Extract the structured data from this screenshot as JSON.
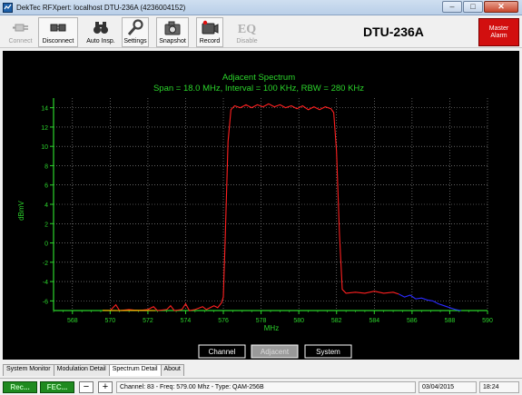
{
  "window": {
    "title": "DekTec RFXpert: localhost  DTU-236A (4236004152)",
    "buttons": {
      "minimize": "–",
      "maximize": "□",
      "close": "✕"
    }
  },
  "toolbar": {
    "items": [
      {
        "label": "Connect",
        "icon": "plug-icon",
        "enabled": false
      },
      {
        "label": "Disconnect",
        "icon": "unplug-icon",
        "enabled": true
      },
      {
        "label": "Auto Insp.",
        "icon": "binoculars-icon",
        "enabled": true
      },
      {
        "label": "Settings",
        "icon": "wrench-icon",
        "enabled": true
      },
      {
        "label": "Snapshot",
        "icon": "camera-icon",
        "enabled": true
      },
      {
        "label": "Record",
        "icon": "record-icon",
        "enabled": true
      },
      {
        "label": "Disable",
        "icon": "eq-icon",
        "enabled": false,
        "icon_text": "EQ"
      }
    ],
    "device_name": "DTU-236A",
    "alarm": {
      "line1": "Master",
      "line2": "Alarm",
      "color": "#d20f0f"
    }
  },
  "chart_data": {
    "type": "line",
    "title": "Adjacent Spectrum",
    "subtitle": "Span = 18.0 MHz, Interval = 100 KHz, RBW = 280 KHz",
    "xlabel": "MHz",
    "ylabel": "dBmV",
    "xlim": [
      567,
      590
    ],
    "ylim": [
      -7,
      15
    ],
    "xticks": [
      568,
      570,
      572,
      574,
      576,
      578,
      580,
      582,
      584,
      586,
      588,
      590
    ],
    "yticks": [
      -6,
      -4,
      -2,
      0,
      2,
      4,
      6,
      8,
      10,
      12,
      14
    ],
    "grid": true,
    "colors": {
      "axis": "#2bd42b",
      "title": "#2bd42b",
      "grid": "#9a9a9a",
      "background": "#000000"
    },
    "series": [
      {
        "color": "#ff2020",
        "points": [
          [
            570.0,
            -7.0
          ],
          [
            570.3,
            -6.4
          ],
          [
            570.5,
            -7.0
          ],
          [
            571.0,
            -6.9
          ],
          [
            571.5,
            -7.0
          ],
          [
            572.0,
            -6.9
          ],
          [
            572.3,
            -6.6
          ],
          [
            572.5,
            -7.0
          ],
          [
            573.0,
            -6.9
          ],
          [
            573.2,
            -6.5
          ],
          [
            573.4,
            -7.0
          ],
          [
            573.8,
            -6.9
          ],
          [
            574.0,
            -6.3
          ],
          [
            574.2,
            -7.0
          ],
          [
            574.5,
            -6.9
          ],
          [
            574.9,
            -6.6
          ],
          [
            575.1,
            -6.9
          ],
          [
            575.5,
            -6.5
          ],
          [
            575.7,
            -6.7
          ],
          [
            575.9,
            -6.2
          ],
          [
            576.0,
            -5.6
          ],
          [
            576.1,
            0.5
          ],
          [
            576.25,
            10.5
          ],
          [
            576.4,
            13.8
          ],
          [
            576.6,
            14.2
          ],
          [
            576.9,
            14.0
          ],
          [
            577.2,
            14.3
          ],
          [
            577.5,
            14.0
          ],
          [
            577.8,
            14.3
          ],
          [
            578.1,
            14.1
          ],
          [
            578.4,
            14.4
          ],
          [
            578.7,
            14.1
          ],
          [
            579.0,
            14.3
          ],
          [
            579.3,
            14.0
          ],
          [
            579.6,
            14.2
          ],
          [
            579.9,
            13.9
          ],
          [
            580.2,
            14.2
          ],
          [
            580.5,
            13.8
          ],
          [
            580.8,
            14.1
          ],
          [
            581.1,
            13.8
          ],
          [
            581.4,
            14.1
          ],
          [
            581.7,
            13.9
          ],
          [
            581.85,
            13.5
          ],
          [
            582.0,
            9.5
          ],
          [
            582.15,
            1.0
          ],
          [
            582.3,
            -4.8
          ],
          [
            582.5,
            -5.2
          ],
          [
            583.0,
            -5.1
          ],
          [
            583.5,
            -5.2
          ],
          [
            584.0,
            -5.0
          ],
          [
            584.5,
            -5.2
          ],
          [
            585.0,
            -5.1
          ],
          [
            585.3,
            -5.3
          ]
        ]
      },
      {
        "color": "#2a2aff",
        "points": [
          [
            585.3,
            -5.3
          ],
          [
            585.6,
            -5.6
          ],
          [
            585.9,
            -5.4
          ],
          [
            586.2,
            -5.8
          ],
          [
            586.5,
            -5.7
          ],
          [
            586.8,
            -5.9
          ],
          [
            587.1,
            -6.0
          ],
          [
            587.4,
            -6.3
          ],
          [
            587.7,
            -6.5
          ],
          [
            588.0,
            -6.7
          ],
          [
            588.3,
            -6.9
          ],
          [
            588.6,
            -7.0
          ]
        ]
      },
      {
        "color": "#ffb000",
        "points": [
          [
            569.6,
            -6.98
          ],
          [
            570.4,
            -7.0
          ],
          [
            571.4,
            -6.97
          ],
          [
            572.4,
            -7.0
          ]
        ]
      }
    ]
  },
  "modes": [
    {
      "label": "Channel",
      "active": false
    },
    {
      "label": "Adjacent",
      "active": true
    },
    {
      "label": "System",
      "active": false
    }
  ],
  "tabs": [
    {
      "label": "System Monitor",
      "active": false
    },
    {
      "label": "Modulation Detail",
      "active": false
    },
    {
      "label": "Spectrum Detail",
      "active": true
    },
    {
      "label": "About",
      "active": false
    }
  ],
  "statusbar": {
    "btn1": "Rec...",
    "btn2": "FEC...",
    "minus": "−",
    "plus": "+",
    "channel_info": "Channel: 83 - Freq: 579.00 Mhz - Type: QAM-256B",
    "date": "03/04/2015",
    "time": "18:24"
  }
}
